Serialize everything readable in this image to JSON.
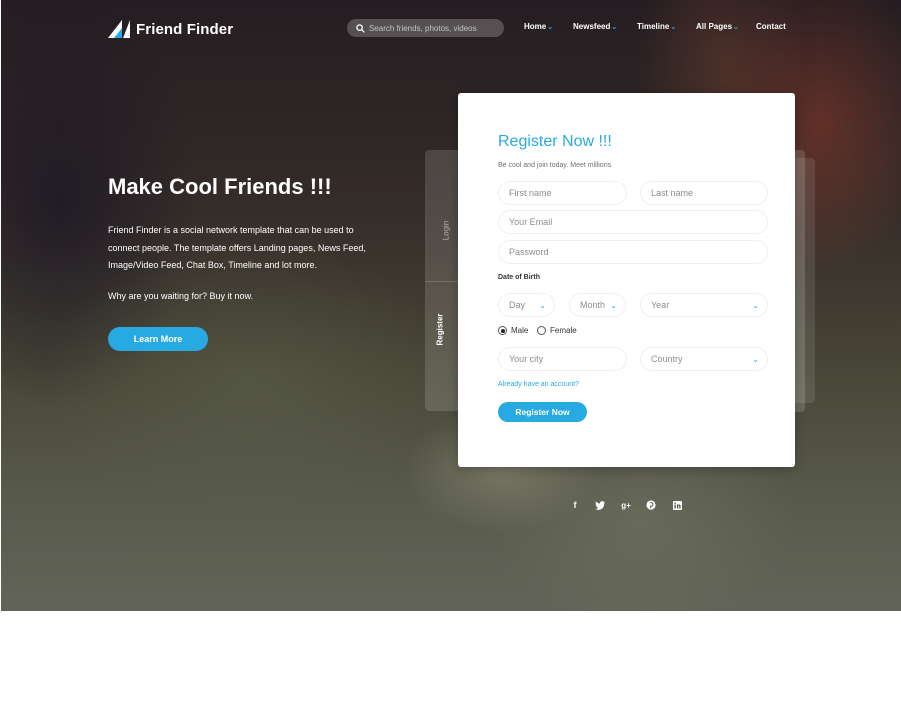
{
  "brand": {
    "name": "Friend Finder"
  },
  "search": {
    "placeholder": "Search friends, photos, videos",
    "icon": "search-icon"
  },
  "nav": {
    "items": [
      {
        "label": "Home",
        "has_dropdown": true
      },
      {
        "label": "Newsfeed",
        "has_dropdown": true
      },
      {
        "label": "Timeline",
        "has_dropdown": true
      },
      {
        "label": "All Pages",
        "has_dropdown": true
      },
      {
        "label": "Contact",
        "has_dropdown": false
      }
    ]
  },
  "hero": {
    "title": "Make Cool Friends !!!",
    "description": "Friend Finder is a social network template that can be used to connect people. The template offers Landing pages, News Feed, Image/Video Feed, Chat Box, Timeline and lot more.",
    "cta_text": "Why are you waiting for? Buy it now.",
    "button_label": "Learn More"
  },
  "tabs": {
    "login": "Login",
    "register": "Register",
    "active": "Register"
  },
  "register_form": {
    "title": "Register Now !!!",
    "subtitle": "Be cool and join today. Meet millions",
    "first_name_placeholder": "First name",
    "last_name_placeholder": "Last name",
    "email_placeholder": "Your Email",
    "password_placeholder": "Password",
    "dob_label": "Date of Birth",
    "day_label": "Day",
    "month_label": "Month",
    "year_label": "Year",
    "gender_male": "Male",
    "gender_female": "Female",
    "gender_selected": "Male",
    "city_placeholder": "Your city",
    "country_label": "Country",
    "account_link": "Already have an account?",
    "submit_label": "Register Now"
  },
  "social": [
    "facebook-icon",
    "twitter-icon",
    "google-plus-icon",
    "pinterest-icon",
    "linkedin-icon"
  ],
  "colors": {
    "accent": "#27aae1",
    "card_bg": "#ffffff",
    "text_dark": "#343434",
    "text_muted": "#8a8d91"
  }
}
